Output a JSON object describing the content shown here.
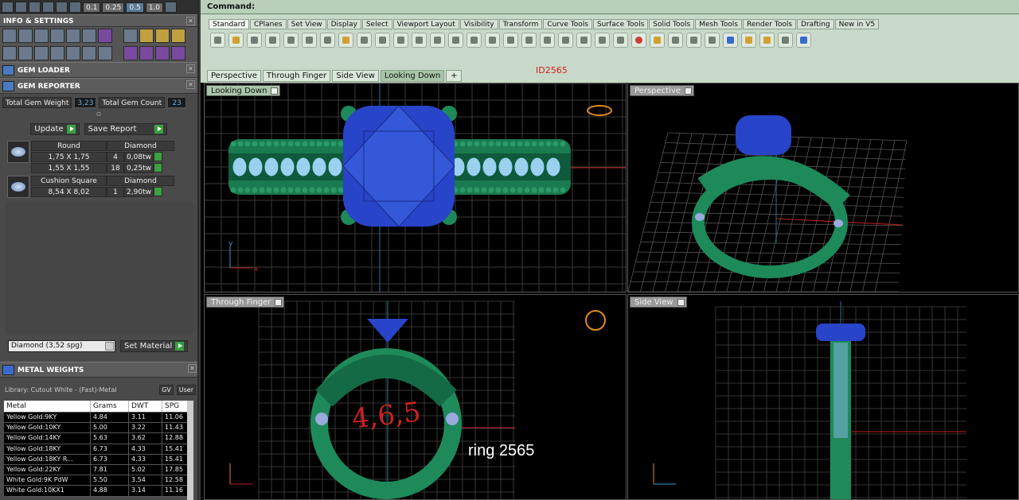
{
  "topstrip": {
    "nums": [
      "0.1",
      "0.25",
      "0.5",
      "1.0"
    ]
  },
  "info_settings": {
    "title": "INFO & SETTINGS"
  },
  "gem_loader": {
    "title": "GEM LOADER"
  },
  "gem_reporter": {
    "title": "GEM REPORTER",
    "total_weight_label": "Total Gem Weight",
    "total_weight_value": "3,23",
    "total_count_label": "Total Gem Count",
    "total_count_value": "23",
    "update_label": "Update",
    "save_report_label": "Save Report",
    "gems": [
      {
        "shape": "Round",
        "material": "Diamond",
        "rows": [
          {
            "size": "1,75 X 1,75",
            "count": "4",
            "weight": "0,08tw"
          },
          {
            "size": "1,55 X 1,55",
            "count": "18",
            "weight": "0,25tw"
          }
        ]
      },
      {
        "shape": "Cushion Square",
        "material": "Diamond",
        "rows": [
          {
            "size": "8,54 X 8,02",
            "count": "1",
            "weight": "2,90tw"
          }
        ]
      }
    ],
    "material_select": "Diamond     (3,52 spg)",
    "set_material_label": "Set Material"
  },
  "metal_weights": {
    "title": "METAL WEIGHTS",
    "library": "Library: Cutout White - (Fast)-Metal",
    "gv_label": "GV",
    "user_label": "User",
    "columns": [
      "Metal",
      "Grams",
      "DWT",
      "SPG"
    ],
    "rows": [
      [
        "Yellow Gold:9KY",
        "4.84",
        "3.11",
        "11.06"
      ],
      [
        "Yellow Gold:10KY",
        "5.00",
        "3.22",
        "11.43"
      ],
      [
        "Yellow Gold:14KY",
        "5.63",
        "3.62",
        "12.88"
      ],
      [
        "Yellow Gold:18KY",
        "6.73",
        "4.33",
        "15.41"
      ],
      [
        "Yellow Gold:18KY R...",
        "6.73",
        "4.33",
        "15.41"
      ],
      [
        "Yellow Gold:22KY",
        "7.81",
        "5.02",
        "17.85"
      ],
      [
        "White Gold:9K PdW",
        "5.50",
        "3.54",
        "12.58"
      ],
      [
        "White Gold:10KX1",
        "4.88",
        "3.14",
        "11.16"
      ]
    ]
  },
  "command": {
    "label": "Command:"
  },
  "toolbar_tabs": [
    "Standard",
    "CPlanes",
    "Set View",
    "Display",
    "Select",
    "Viewport Layout",
    "Visibility",
    "Transform",
    "Curve Tools",
    "Surface Tools",
    "Solid Tools",
    "Mesh Tools",
    "Render Tools",
    "Drafting",
    "New in V5"
  ],
  "viewport_tabs": [
    "Perspective",
    "Through Finger",
    "Side View",
    "Looking Down",
    "+"
  ],
  "id_label": "ID2565",
  "viewports": {
    "top_left": "Looking Down",
    "top_right": "Perspective",
    "bottom_left": "Through Finger",
    "bottom_right": "Side View"
  },
  "annotation": "ring 2565",
  "handwritten": "4,6,5",
  "colors": {
    "metal": "#1e8a5a",
    "stone": "#2844c8",
    "accent": "#a9c5a9"
  }
}
